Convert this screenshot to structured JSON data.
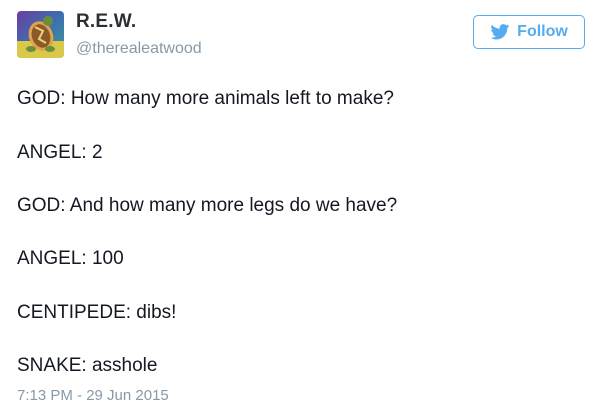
{
  "author": {
    "display_name": "R.E.W.",
    "handle": "@therealeatwood",
    "avatar_icon": "tortoise-avatar-icon"
  },
  "follow_button": {
    "label": "Follow",
    "icon": "twitter-bird-icon",
    "color": "#55acee"
  },
  "tweet": {
    "lines": [
      "GOD: How many more animals left to make?",
      "ANGEL: 2",
      "GOD: And how many more legs do we have?",
      "ANGEL: 100",
      "CENTIPEDE: dibs!",
      "SNAKE: asshole"
    ],
    "timestamp": "7:13 PM - 29 Jun 2015"
  }
}
